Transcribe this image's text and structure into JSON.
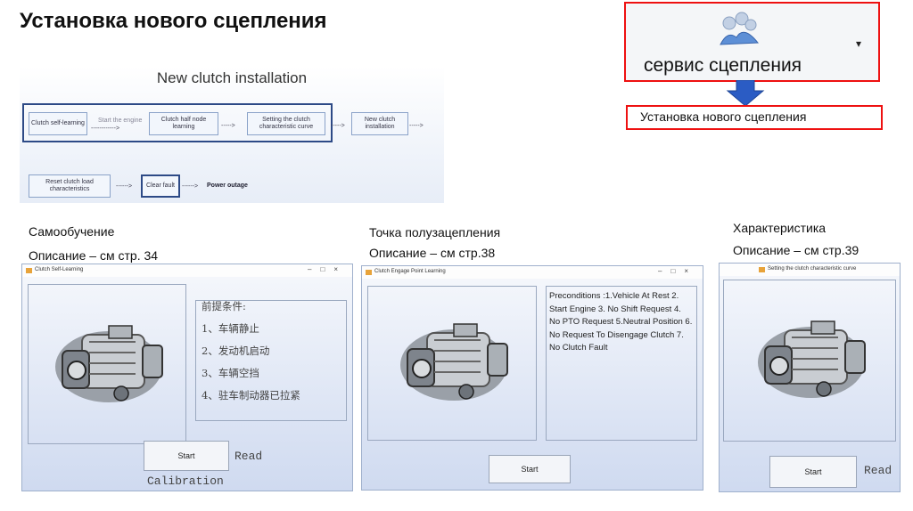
{
  "slide": {
    "title": "Установка нового сцепления"
  },
  "diagram": {
    "title": "New clutch installation",
    "box_self_learning": "Clutch self-learning",
    "arrow_start_engine": "Start the engine",
    "box_half_node": "Clutch half node learning",
    "box_curve": "Setting the clutch characteristic curve",
    "box_new_install": "New clutch installation",
    "box_reset": "Reset clutch load characteristics",
    "box_clear_fault": "Clear fault",
    "label_power_outage": "Power outage",
    "arrow_text_long": "------------>",
    "arrow_text_short": "----->",
    "arrow_text_mid": "------>"
  },
  "menu": {
    "service_label": "сервис сцепления",
    "dropdown_glyph": "▾",
    "item_new_clutch": "Установка нового сцепления",
    "colors": {
      "highlight": "#e11111",
      "arrow": "#2b5cc4"
    }
  },
  "captions": {
    "self_learning": "Самообучение",
    "self_learning_desc": "Описание – см стр. 34",
    "half_point": "Точка полузацепления",
    "half_point_desc": "Описание – см стр.38",
    "characteristic": "Характеристика",
    "characteristic_desc": "Описание – см стр.39"
  },
  "win1": {
    "title": "Clutch Self-Learning",
    "controls": "–□×",
    "preconditions_cn": "前提条件:\n1、车辆静止\n2、发动机启动\n3、车辆空挡\n4、驻车制动器已拉紧",
    "start_button": "Start",
    "read_label": "Read",
    "calibration_label": "Calibration"
  },
  "win2": {
    "title": "Clutch Engage Point Learning",
    "controls": "–□×",
    "preconditions": "Preconditions :1.Vehicle At Rest 2. Start Engine 3. No Shift Request 4. No PTO Request 5.Neutral Position 6. No Request To Disengage Clutch 7. No Clutch Fault",
    "start_button": "Start"
  },
  "win3": {
    "title": "Setting the clutch characteristic curve",
    "start_button": "Start",
    "read_label": "Read"
  }
}
